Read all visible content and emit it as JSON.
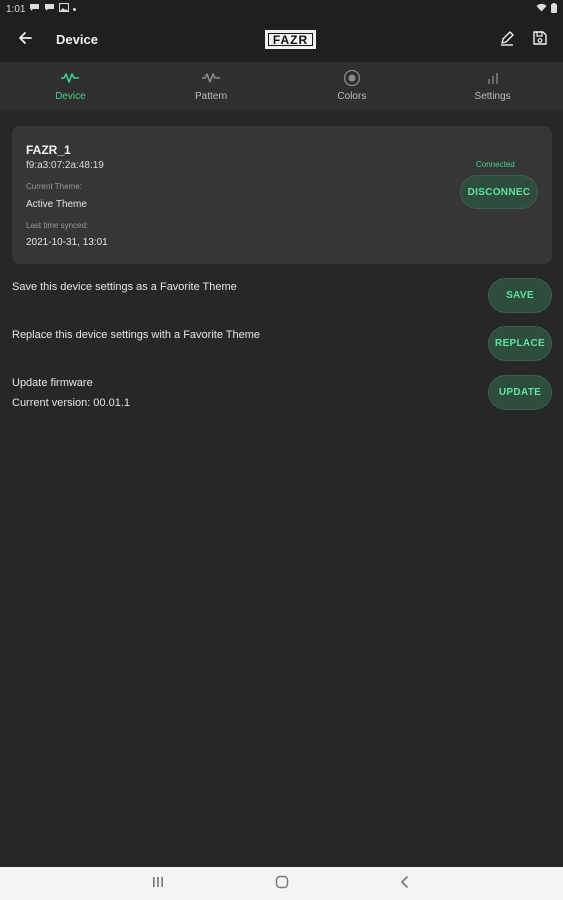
{
  "status_bar": {
    "time": "1:01",
    "icons": [
      "chat-bubble-icon",
      "chat-bubble-icon",
      "photo-icon",
      "dot-icon"
    ],
    "right_icons": [
      "wifi-icon",
      "battery-icon"
    ]
  },
  "app_bar": {
    "title": "Device",
    "logo_text": "FAZR",
    "back_icon": "arrow-left-icon",
    "edit_icon": "pencil-icon",
    "save_icon": "floppy-disk-icon"
  },
  "tabs": [
    {
      "label": "Device",
      "icon": "waveform-icon",
      "active": true
    },
    {
      "label": "Pattern",
      "icon": "waveform-icon",
      "active": false
    },
    {
      "label": "Colors",
      "icon": "target-icon",
      "active": false
    },
    {
      "label": "Settings",
      "icon": "bars-icon",
      "active": false
    }
  ],
  "device_card": {
    "name": "FAZR_1",
    "mac": "f9:a3:07:2a:48:19",
    "current_theme_caption": "Current Theme:",
    "current_theme_value": "Active Theme",
    "last_synced_caption": "Last time synced:",
    "last_synced_value": "2021-10-31, 13:01",
    "connection_status": "Connected",
    "disconnect_label": "DISCONNEC"
  },
  "rows": {
    "favorite_save_text": "Save this device settings as a Favorite Theme",
    "save_label": "SAVE",
    "favorite_replace_text": "Replace this device settings with a Favorite Theme",
    "replace_label": "REPLACE",
    "firmware_text": "Update firmware",
    "firmware_version": "Current version: 00.01.1",
    "update_label": "UPDATE"
  },
  "nav_bar": {
    "items": [
      "recent-apps-icon",
      "home-icon",
      "back-icon"
    ]
  },
  "colors": {
    "accent": "#43d18b",
    "background": "#272727",
    "card": "#363636",
    "button_bg": "#2f4d3c"
  }
}
